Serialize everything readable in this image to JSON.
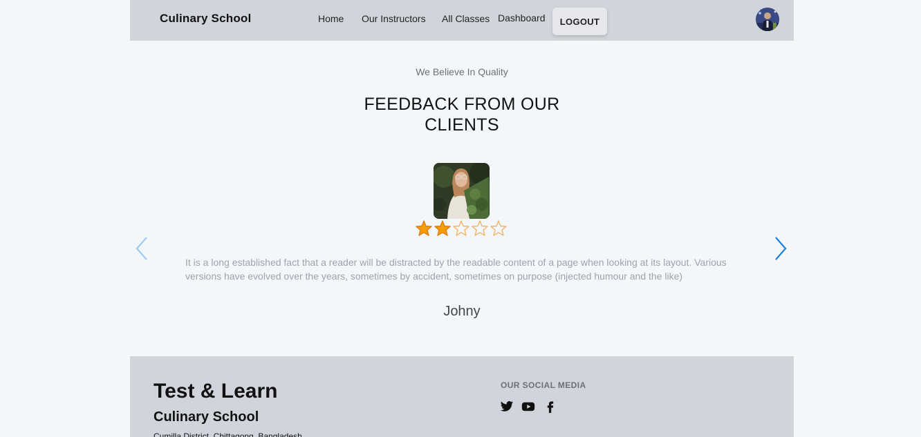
{
  "navbar": {
    "brand": "Culinary School",
    "links": [
      "Home",
      "Our Instructors",
      "All Classes",
      "Dashboard"
    ],
    "logout_label": "LOGOUT"
  },
  "feedback": {
    "subtitle": "We Believe In Quality",
    "heading": "FEEDBACK FROM OUR CLIENTS",
    "rating": 2,
    "rating_max": 5,
    "quote": "It is a long established fact that a reader will be distracted by the readable content of a page when looking at its layout. Various versions have evolved over the years, sometimes by accident, sometimes on purpose (injected humour and the like)",
    "client_name": "Johny"
  },
  "footer": {
    "title": "Test & Learn",
    "subtitle": "Culinary School",
    "address": "Cumilla District, Chittagong, Bangladesh",
    "social_title": "OUR SOCIAL MEDIA",
    "social_icons": [
      "twitter-icon",
      "youtube-icon",
      "facebook-icon"
    ]
  },
  "colors": {
    "page_bg": "#f3f7fa",
    "nav_bg": "#d1d5db",
    "star_filled": "#f59e0b",
    "star_empty_outline": "#f3b266",
    "arrow_active": "#1d7ed8",
    "arrow_disabled": "#9ecbf2"
  }
}
